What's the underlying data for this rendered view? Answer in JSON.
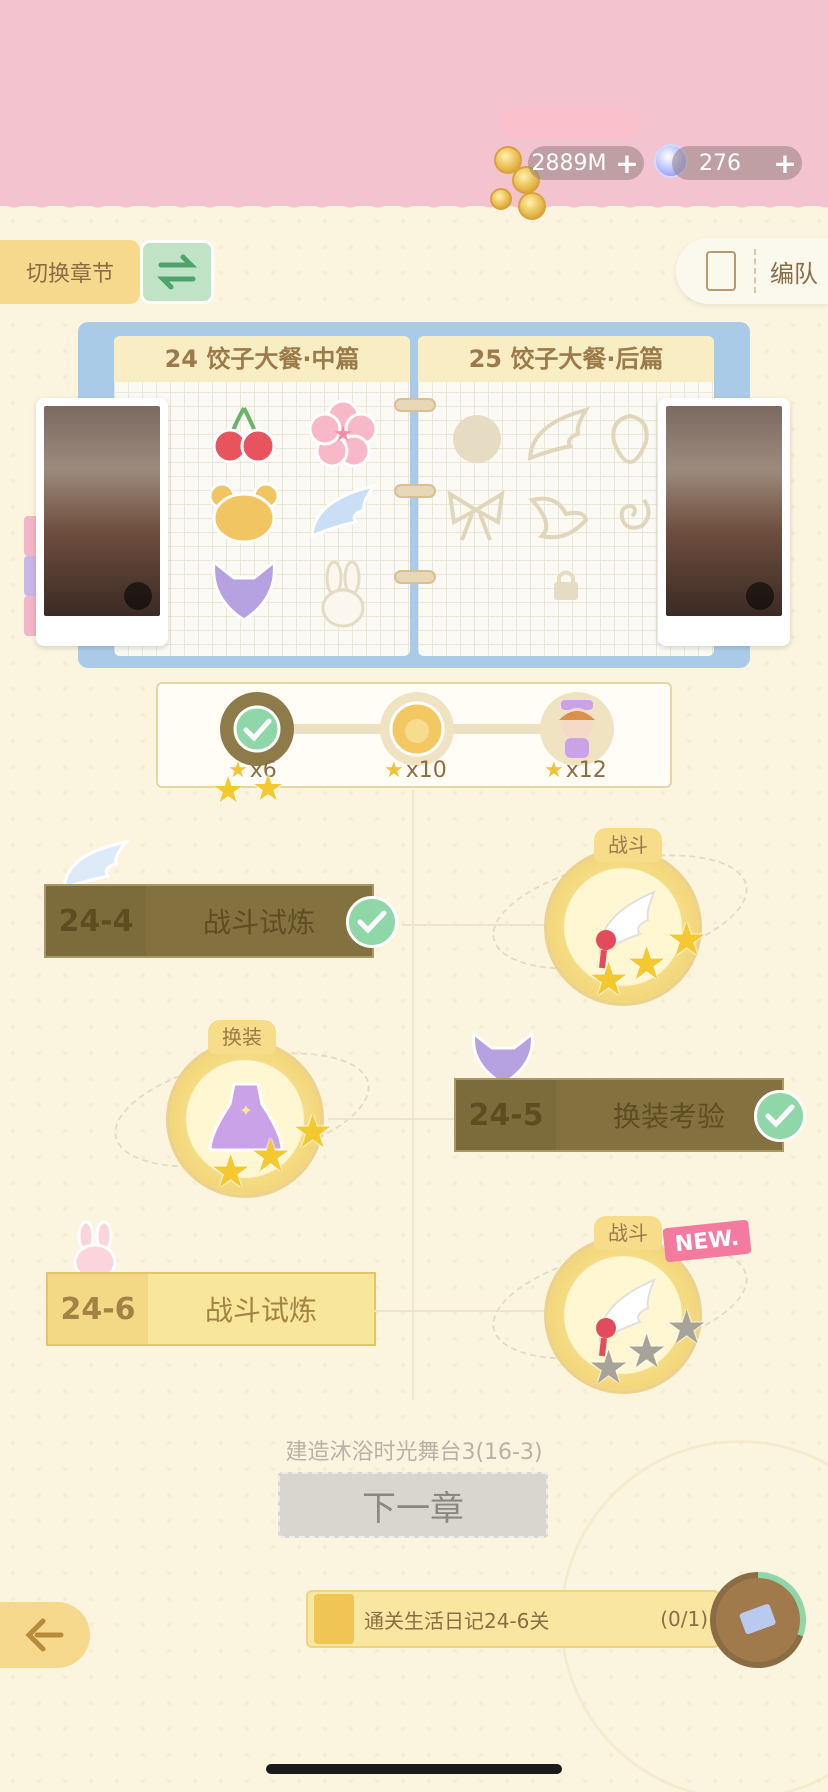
{
  "currency": {
    "gold": "2889M",
    "diamond": "276",
    "plus": "+"
  },
  "header": {
    "switch_chapter_label": "切换章节",
    "team_label": "编队"
  },
  "diary": {
    "left_page_title": "24 饺子大餐·中篇",
    "right_page_title": "25 饺子大餐·后篇"
  },
  "progress": {
    "rewards": [
      {
        "stars": "x6",
        "state": "claimed"
      },
      {
        "stars": "x10",
        "state": "locked"
      },
      {
        "stars": "x12",
        "state": "locked"
      }
    ]
  },
  "stages": [
    {
      "id": "24-4",
      "name": "战斗试炼",
      "completed": true,
      "type_tag": "战斗",
      "stars": 3
    },
    {
      "id": "24-5",
      "name": "换装考验",
      "completed": true,
      "type_tag": "换装",
      "stars": 3
    },
    {
      "id": "24-6",
      "name": "战斗试炼",
      "completed": false,
      "type_tag": "战斗",
      "stars": 0,
      "badge": "NEW."
    }
  ],
  "next_chapter": {
    "hint": "建造沐浴时光舞台3(16-3)",
    "label": "下一章"
  },
  "task": {
    "text": "通关生活日记24-6关",
    "count": "(0/1)"
  },
  "colors": {
    "top_band": "#f3c3cf",
    "background": "#fbf5df",
    "completed_bar": "#837240",
    "open_bar": "#f8e79b",
    "check_green": "#8fd6a8",
    "star_gold": "#f4c930",
    "new_badge": "#f57aa0"
  }
}
